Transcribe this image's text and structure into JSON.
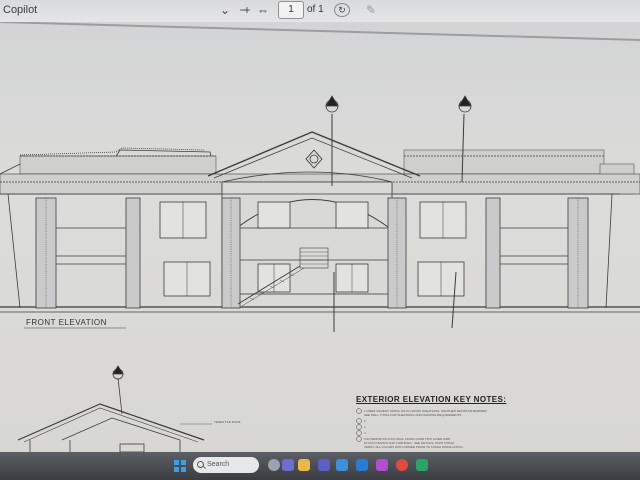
{
  "app": {
    "title": "Copilot"
  },
  "toolbar": {
    "dropdown": "⌄",
    "zoom_out": "−",
    "zoom_in": "+",
    "fit": "⇔",
    "page_value": "1",
    "page_of": "of 1",
    "rotate": "↻",
    "draw": "✎"
  },
  "drawing": {
    "front_elevation_label": "FRONT ELEVATION",
    "notes_title": "EXTERIOR ELEVATION KEY NOTES:",
    "roof_tile_note": "TERRA TILE ROOF",
    "notes": [
      "1  FIBER CEMENT SIDING ON PLYWOOD SHEATHING, WEATHER-RESISTIVE BARRIER",
      "   SEE WALL TYPES FOR SHEATHING AND FRAMING REQUIREMENTS",
      "2",
      "3",
      "4",
      "5  EXTERIOR STUCCO WALL FINISH OVER TWO LAYER WRB",
      "   STUCCO BANDS AND CORNICES - SEE DETAILS, PAINT FINISH",
      "   VERIFY ALL COLORS WITH OWNER PRIOR TO FINISH INSTALLATION"
    ]
  },
  "taskbar": {
    "search_placeholder": "Search",
    "pinned_icons": [
      "widgets-icon",
      "chat-icon",
      "file-explorer-icon",
      "teams-icon",
      "photos-icon",
      "mail-icon",
      "edge-icon",
      "chrome-icon",
      "store-icon"
    ]
  },
  "colors": {
    "accent": "#3aa0e8",
    "line": "#3c3c3c"
  }
}
